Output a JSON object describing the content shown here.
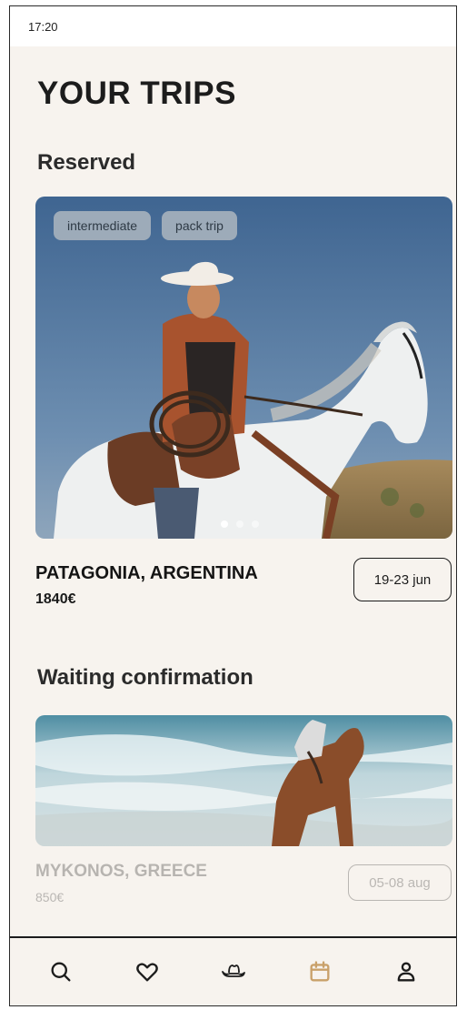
{
  "status_bar": {
    "time": "17:20"
  },
  "page": {
    "title": "YOUR TRIPS"
  },
  "sections": {
    "reserved": {
      "title": "Reserved",
      "trip": {
        "tags": [
          "intermediate",
          "pack trip"
        ],
        "name": "PATAGONIA, ARGENTINA",
        "price": "1840€",
        "dates": "19-23 jun",
        "carousel": {
          "count": 3,
          "active_index": 0
        }
      }
    },
    "waiting": {
      "title": "Waiting confirmation",
      "trip": {
        "name": "MYKONOS, GREECE",
        "price": "850€",
        "dates": "05-08 aug"
      }
    }
  },
  "tab_bar": {
    "items": [
      {
        "icon": "search-icon"
      },
      {
        "icon": "heart-icon"
      },
      {
        "icon": "cowboy-hat-icon"
      },
      {
        "icon": "calendar-icon",
        "active": true
      },
      {
        "icon": "profile-icon"
      }
    ],
    "active_color": "#c9a16a",
    "inactive_color": "#1c1c1c"
  }
}
